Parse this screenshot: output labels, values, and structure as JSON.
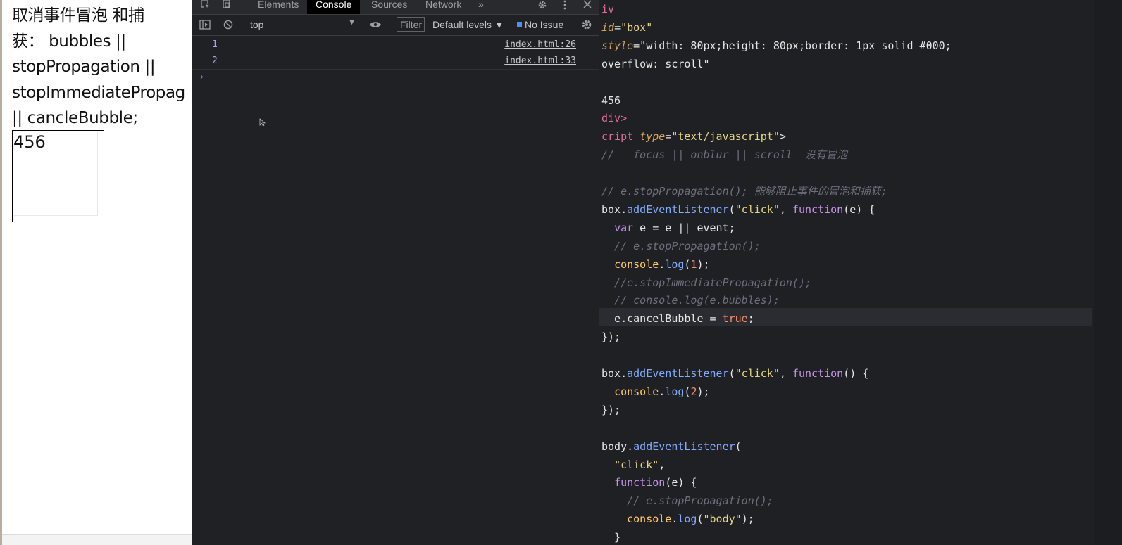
{
  "browser_page": {
    "lines": [
      "取消事件冒泡 和捕",
      "获： bubbles ||",
      "stopPropagation ||",
      "stopImmediatePropag",
      "|| cancleBubble;"
    ],
    "box_text": "456"
  },
  "devtools": {
    "tabs": [
      "Elements",
      "Console",
      "Sources",
      "Network"
    ],
    "active_tab": "Console",
    "more_tabs": "»",
    "toolbar": {
      "context": "top",
      "filter_placeholder": "Filter",
      "levels": "Default levels ▼",
      "issues": "No Issue"
    },
    "console_rows": [
      {
        "value": "1",
        "source": "index.html:26"
      },
      {
        "value": "2",
        "source": "index.html:33"
      }
    ],
    "prompt": "›"
  },
  "editor": {
    "lines": [
      "iv",
      "id=\"box\"",
      "style=\"width: 80px;height: 80px;border: 1px solid #000;",
      "overflow: scroll\"",
      "",
      "456",
      "div>",
      "cript type=\"text/javascript\">",
      "//   focus || onblur || scroll  没有冒泡",
      "",
      "// e.stopPropagation(); 能够阻止事件的冒泡和捕获;",
      "box.addEventListener(\"click\", function(e) {",
      "  var e = e || event;",
      "  // e.stopPropagation();",
      "  console.log(1);",
      "  //e.stopImmediatePropagation();",
      "  // console.log(e.bubbles);",
      "  e.cancelBubble = true;",
      "});",
      "",
      "box.addEventListener(\"click\", function() {",
      "  console.log(2);",
      "});",
      "",
      "body.addEventListener(",
      "  \"click\",",
      "  function(e) {",
      "    // e.stopPropagation();",
      "    console.log(\"body\");",
      "  }"
    ],
    "highlight_line": 17
  }
}
